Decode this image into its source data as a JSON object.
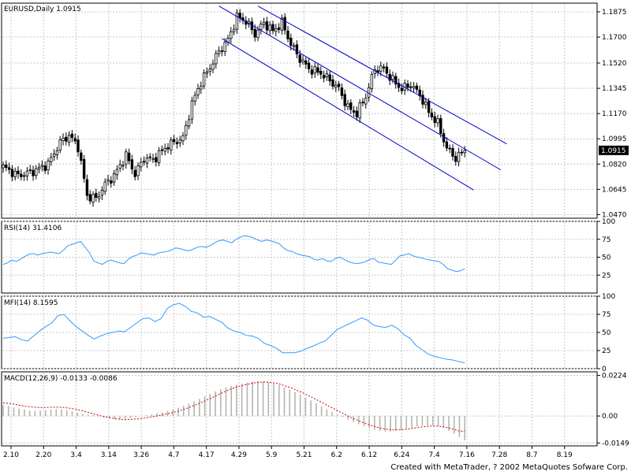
{
  "colors": {
    "background": "#ffffff",
    "grid": "#c8c8c8",
    "candle": "#000000",
    "channel": "#0000cc",
    "rsi_line": "#3399ff",
    "mfi_line": "#3399ff",
    "macd_hist": "#b4b4b4",
    "macd_signal": "#cc0000"
  },
  "footer": "Created with MetaTrader, ? 2002 MetaQuotes Sofware Corp.",
  "chart_data": [
    {
      "type": "candlestick",
      "title": "EURUSD,Daily  1.0915",
      "current_price": "1.0915",
      "y_ticks": [
        "1.1875",
        "1.1700",
        "1.1520",
        "1.1345",
        "1.1170",
        "1.0995",
        "1.0820",
        "1.0645",
        "1.0470"
      ],
      "ylim": [
        1.0445,
        1.1935
      ],
      "x_ticks": [
        "2.10",
        "2.20",
        "3.4",
        "3.14",
        "3.26",
        "4.7",
        "4.17",
        "4.29",
        "5.9",
        "5.21",
        "6.2",
        "6.12",
        "6.24",
        "7.4",
        "7.16",
        "7.28",
        "8.7",
        "8.19"
      ],
      "grid": true,
      "channel_lines": [
        {
          "from": {
            "bar": 85,
            "price": 1.1915
          },
          "to": {
            "bar": 168,
            "price": 1.096
          }
        },
        {
          "from": {
            "bar": 72,
            "price": 1.1915
          },
          "to": {
            "bar": 166,
            "price": 1.078
          }
        },
        {
          "from": {
            "bar": 73,
            "price": 1.169
          },
          "to": {
            "bar": 157,
            "price": 1.064
          }
        }
      ],
      "close_anchors": [
        [
          0,
          1.08
        ],
        [
          5,
          1.074
        ],
        [
          10,
          1.077
        ],
        [
          15,
          1.082
        ],
        [
          19,
          1.097
        ],
        [
          22,
          1.102
        ],
        [
          25,
          1.094
        ],
        [
          28,
          1.06
        ],
        [
          31,
          1.058
        ],
        [
          34,
          1.068
        ],
        [
          37,
          1.074
        ],
        [
          41,
          1.088
        ],
        [
          44,
          1.075
        ],
        [
          47,
          1.086
        ],
        [
          50,
          1.085
        ],
        [
          55,
          1.095
        ],
        [
          60,
          1.1
        ],
        [
          63,
          1.124
        ],
        [
          66,
          1.139
        ],
        [
          69,
          1.149
        ],
        [
          72,
          1.16
        ],
        [
          75,
          1.168
        ],
        [
          78,
          1.184
        ],
        [
          81,
          1.181
        ],
        [
          84,
          1.172
        ],
        [
          87,
          1.18
        ],
        [
          90,
          1.174
        ],
        [
          93,
          1.18
        ],
        [
          96,
          1.165
        ],
        [
          99,
          1.155
        ],
        [
          102,
          1.148
        ],
        [
          106,
          1.145
        ],
        [
          109,
          1.14
        ],
        [
          112,
          1.134
        ],
        [
          115,
          1.121
        ],
        [
          118,
          1.117
        ],
        [
          121,
          1.129
        ],
        [
          124,
          1.148
        ],
        [
          127,
          1.148
        ],
        [
          130,
          1.14
        ],
        [
          133,
          1.134
        ],
        [
          136,
          1.137
        ],
        [
          139,
          1.13
        ],
        [
          142,
          1.118
        ],
        [
          145,
          1.11
        ],
        [
          148,
          1.093
        ],
        [
          151,
          1.086
        ],
        [
          154,
          1.0915
        ]
      ]
    },
    {
      "type": "line",
      "title": "RSI(14)  31.4106",
      "y_ticks": [
        "100",
        "75",
        "50",
        "25"
      ],
      "ylim": [
        0,
        100
      ],
      "series": [
        {
          "values": [
            40,
            42,
            46,
            44,
            47,
            51,
            54,
            55,
            53,
            55,
            56,
            57,
            56,
            55,
            60,
            66,
            68,
            70,
            72,
            64,
            56,
            45,
            42,
            40,
            44,
            46,
            44,
            42,
            41,
            47,
            51,
            53,
            56,
            55,
            54,
            53,
            56,
            57,
            58,
            60,
            63,
            62,
            60,
            59,
            61,
            64,
            65,
            64,
            66,
            70,
            73,
            74,
            72,
            70,
            75,
            78,
            80,
            79,
            77,
            74,
            72,
            74,
            73,
            71,
            69,
            63,
            59,
            58,
            55,
            53,
            52,
            51,
            47,
            46,
            48,
            45,
            44,
            48,
            50,
            47,
            44,
            42,
            41,
            42,
            44,
            47,
            48,
            43,
            42,
            41,
            40,
            46,
            52,
            53,
            55,
            52,
            50,
            49,
            47,
            46,
            45,
            44,
            40,
            34,
            32,
            30,
            31,
            34
          ]
        }
      ]
    },
    {
      "type": "line",
      "title": "MFI(14)  8.1595",
      "y_ticks": [
        "100",
        "75",
        "50",
        "25",
        "0"
      ],
      "ylim": [
        0,
        100
      ],
      "series": [
        {
          "values": [
            42,
            43,
            44,
            40,
            38,
            45,
            52,
            58,
            63,
            73,
            75,
            66,
            58,
            52,
            46,
            41,
            45,
            48,
            50,
            52,
            51,
            57,
            63,
            69,
            70,
            65,
            69,
            83,
            88,
            90,
            86,
            79,
            77,
            71,
            72,
            68,
            64,
            56,
            52,
            50,
            46,
            45,
            42,
            35,
            32,
            28,
            22,
            22,
            22,
            24,
            28,
            31,
            35,
            38,
            46,
            54,
            58,
            62,
            66,
            70,
            67,
            60,
            58,
            57,
            60,
            55,
            47,
            42,
            32,
            26,
            20,
            17,
            15,
            13,
            12,
            10,
            8
          ]
        }
      ]
    },
    {
      "type": "bar",
      "title": "MACD(12,26,9)  -0.0133  -0.0086",
      "y_ticks": [
        "0.0224",
        "0.00",
        "-0.0149"
      ],
      "ylim": [
        -0.0165,
        0.0244
      ],
      "series": [
        {
          "name": "histogram",
          "values": [
            0.006,
            0.0055,
            0.0048,
            0.004,
            0.0035,
            0.003,
            0.0028,
            0.0029,
            0.0032,
            0.0035,
            0.0038,
            0.0036,
            0.0032,
            0.0026,
            0.0018,
            0.0012,
            0.0008,
            0.0004,
            -0.0002,
            -0.0008,
            -0.0014,
            -0.0018,
            -0.0019,
            -0.0016,
            -0.0011,
            -0.0006,
            -0.0001,
            0.0004,
            0.0009,
            0.0014,
            0.002,
            0.0028,
            0.0036,
            0.0045,
            0.0056,
            0.0068,
            0.008,
            0.0094,
            0.0108,
            0.0122,
            0.0136,
            0.0148,
            0.0158,
            0.0166,
            0.0172,
            0.0178,
            0.0184,
            0.019,
            0.0192,
            0.0191,
            0.0186,
            0.0178,
            0.017,
            0.0158,
            0.0146,
            0.0132,
            0.0118,
            0.0102,
            0.0086,
            0.007,
            0.0054,
            0.0038,
            0.0022,
            0.0008,
            -0.0006,
            -0.002,
            -0.0034,
            -0.0046,
            -0.0058,
            -0.0068,
            -0.0076,
            -0.0082,
            -0.0086,
            -0.0086,
            -0.0082,
            -0.0076,
            -0.007,
            -0.0064,
            -0.0058,
            -0.0054,
            -0.0052,
            -0.0052,
            -0.0056,
            -0.0066,
            -0.0082,
            -0.0098,
            -0.0116,
            -0.0133
          ]
        },
        {
          "name": "signal",
          "values": [
            0.0072,
            0.007,
            0.0066,
            0.006,
            0.0055,
            0.0051,
            0.0048,
            0.0047,
            0.0047,
            0.0048,
            0.0049,
            0.0048,
            0.0045,
            0.0041,
            0.0035,
            0.0028,
            0.002,
            0.0012,
            0.0004,
            -0.0003,
            -0.0009,
            -0.0014,
            -0.0018,
            -0.002,
            -0.0019,
            -0.0017,
            -0.0014,
            -0.001,
            -0.0005,
            0.0,
            0.0006,
            0.0012,
            0.0019,
            0.0027,
            0.0036,
            0.0046,
            0.0058,
            0.007,
            0.0083,
            0.0096,
            0.011,
            0.0124,
            0.0138,
            0.015,
            0.016,
            0.0168,
            0.0175,
            0.0181,
            0.0186,
            0.0188,
            0.0187,
            0.0183,
            0.0177,
            0.0168,
            0.0158,
            0.0147,
            0.0134,
            0.012,
            0.0106,
            0.0091,
            0.0076,
            0.006,
            0.0045,
            0.003,
            0.0015,
            0.0,
            -0.0014,
            -0.0026,
            -0.0038,
            -0.0049,
            -0.0058,
            -0.0066,
            -0.0072,
            -0.0076,
            -0.0077,
            -0.0076,
            -0.0073,
            -0.0069,
            -0.0064,
            -0.006,
            -0.0057,
            -0.0055,
            -0.0056,
            -0.006,
            -0.0066,
            -0.0074,
            -0.0083,
            -0.0086
          ]
        }
      ]
    }
  ]
}
